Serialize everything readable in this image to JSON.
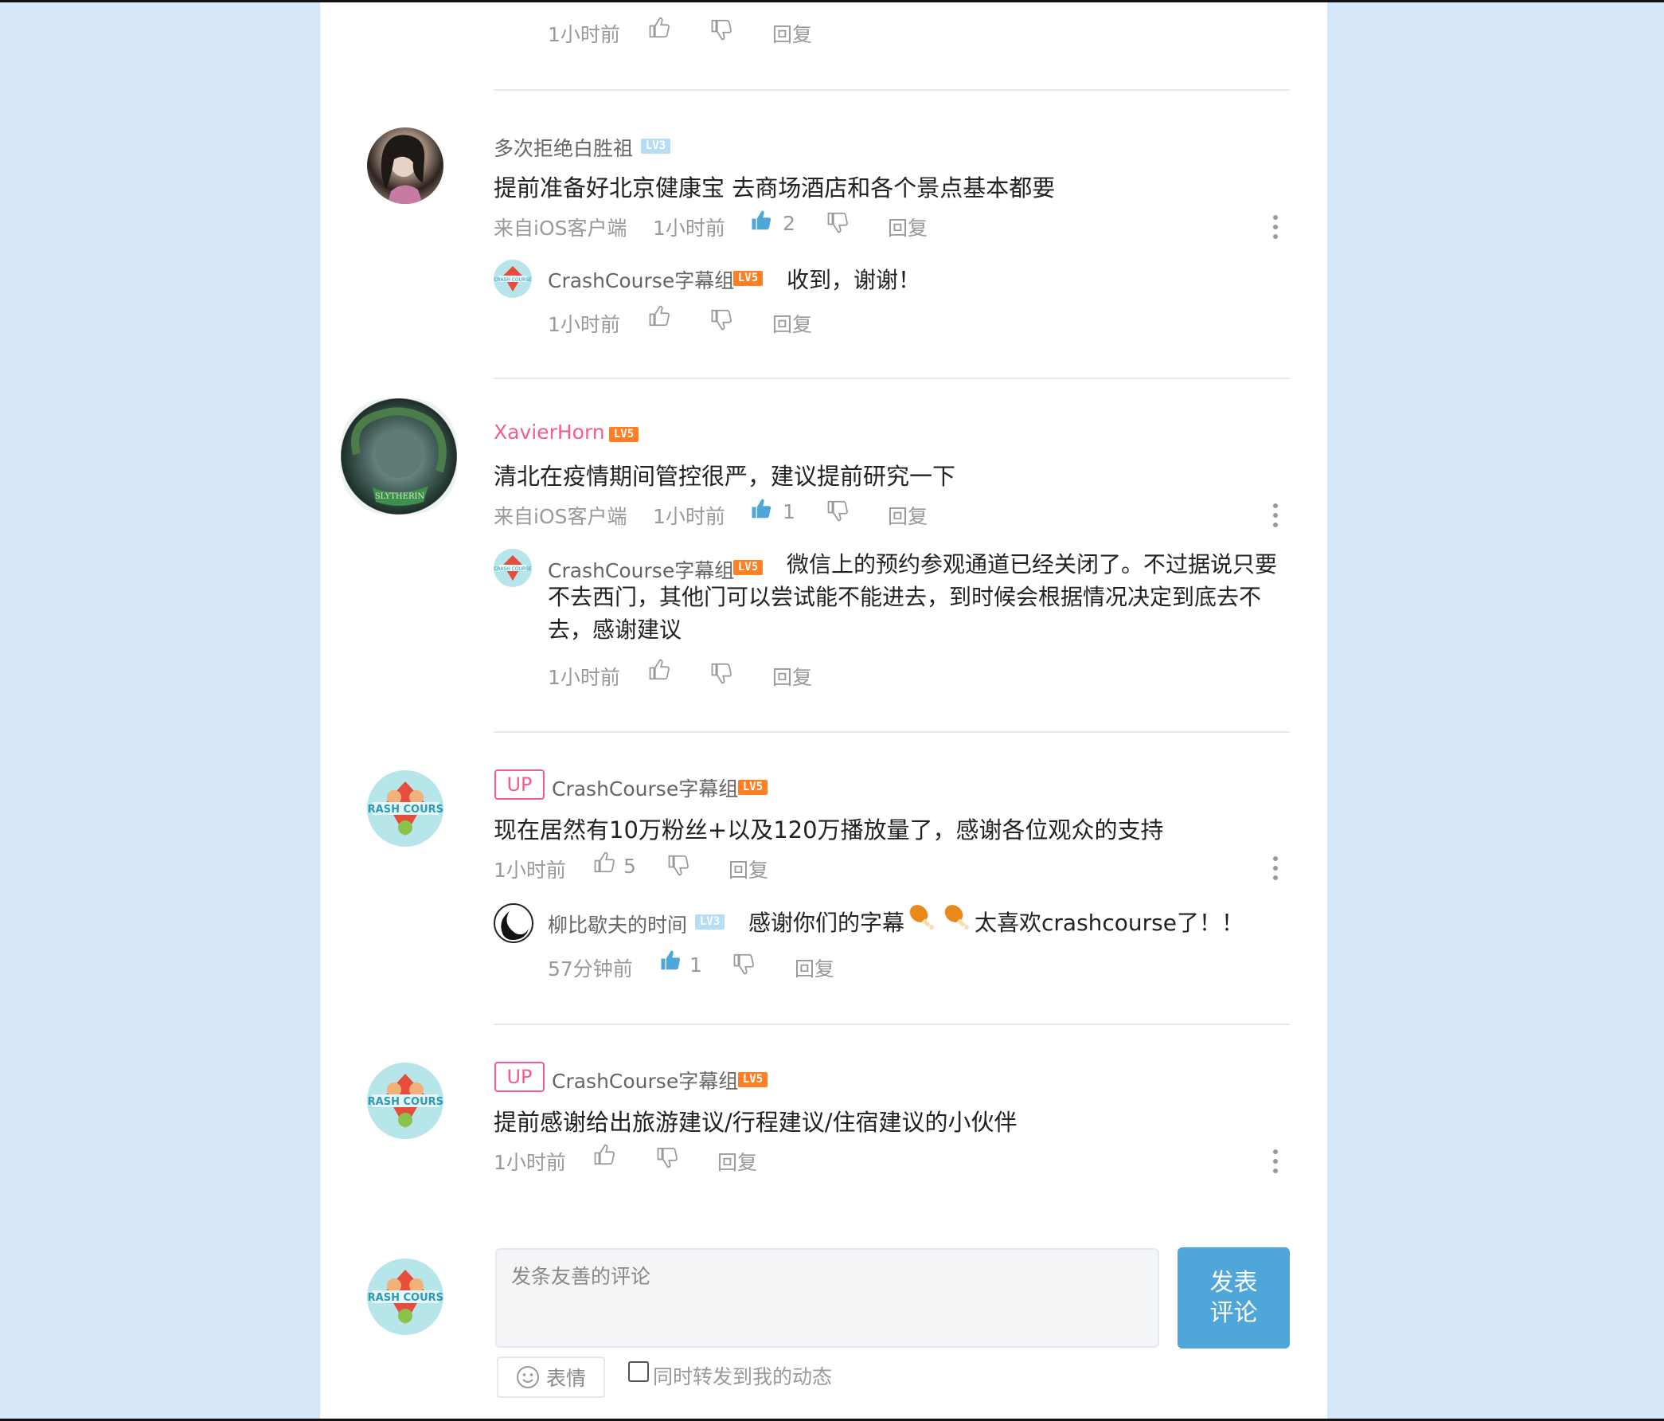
{
  "ui": {
    "like": "赞",
    "reply": "回复",
    "top_reply": {
      "time": "1小时前"
    },
    "comments": [
      {
        "user": "多次拒绝白胜祖",
        "level": "LV3",
        "text": "提前准备好北京健康宝 去商场酒店和各个景点基本都要",
        "source": "来自iOS客户端",
        "time": "1小时前",
        "likes": "2",
        "reply": {
          "user": "CrashCourse字幕组",
          "level": "LV5",
          "text": "收到，谢谢！",
          "time": "1小时前"
        }
      },
      {
        "user": "XavierHorn",
        "level": "LV5",
        "text": "清北在疫情期间管控很严，建议提前研究一下",
        "source": "来自iOS客户端",
        "time": "1小时前",
        "likes": "1",
        "reply": {
          "user": "CrashCourse字幕组",
          "level": "LV5",
          "text_line1": "微信上的预约参观通道已经关闭了。不过据说只要",
          "text_line2": "不去西门，其他门可以尝试能不能进去，到时候会根据情况决定到底去不",
          "text_line3": "去，感谢建议",
          "time": "1小时前"
        }
      },
      {
        "up_badge": "UP",
        "user": "CrashCourse字幕组",
        "level": "LV5",
        "text": "现在居然有10万粉丝+以及120万播放量了，感谢各位观众的支持",
        "time": "1小时前",
        "likes": "5",
        "reply": {
          "user": "柳比歇夫的时间",
          "level": "LV3",
          "text_a": "感谢你们的字幕",
          "text_b": "太喜欢crashcourse了！！",
          "time": "57分钟前",
          "likes": "1"
        }
      },
      {
        "up_badge": "UP",
        "user": "CrashCourse字幕组",
        "level": "LV5",
        "text": "提前感谢给出旅游建议/行程建议/住宿建议的小伙伴",
        "time": "1小时前"
      }
    ],
    "composer": {
      "placeholder": "发条友善的评论",
      "submit_line1": "发表",
      "submit_line2": "评论",
      "emoji_label": "表情",
      "repost_label": "同时转发到我的动态"
    },
    "colors": {
      "accent": "#4fa6d8",
      "up_pink": "#f25d8e",
      "level_orange": "#ff7f24",
      "level_blue": "#b7dcf5"
    }
  }
}
